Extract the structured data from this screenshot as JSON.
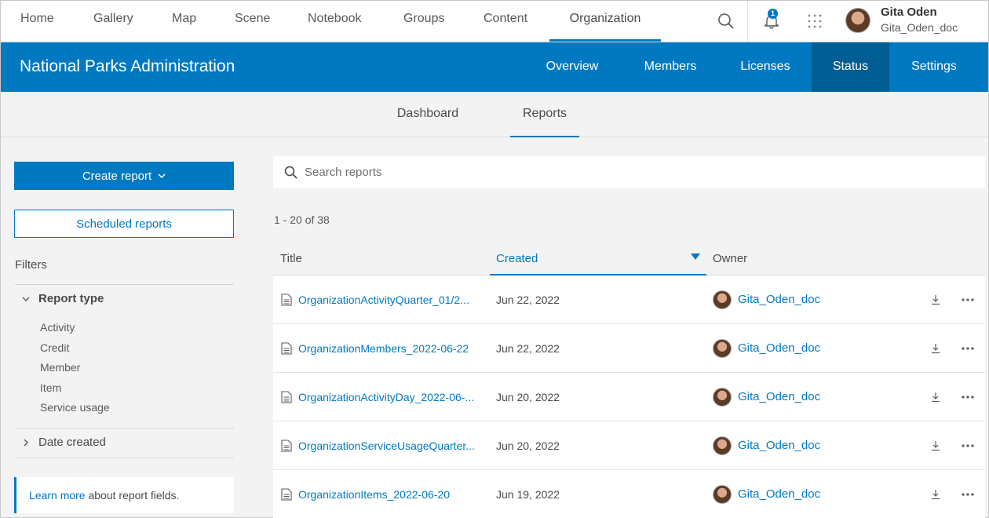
{
  "topnav": {
    "items": [
      {
        "label": "Home"
      },
      {
        "label": "Gallery"
      },
      {
        "label": "Map"
      },
      {
        "label": "Scene"
      },
      {
        "label": "Notebook"
      },
      {
        "label": "Groups"
      },
      {
        "label": "Content"
      },
      {
        "label": "Organization",
        "active": true
      }
    ],
    "notification_count": "1",
    "user": {
      "name": "Gita Oden",
      "username": "Gita_Oden_doc"
    }
  },
  "org": {
    "title": "National Parks Administration",
    "tabs": [
      {
        "label": "Overview"
      },
      {
        "label": "Members"
      },
      {
        "label": "Licenses"
      },
      {
        "label": "Status",
        "active": true
      },
      {
        "label": "Settings"
      }
    ]
  },
  "subtabs": [
    {
      "label": "Dashboard"
    },
    {
      "label": "Reports",
      "active": true
    }
  ],
  "sidebar": {
    "create_label": "Create report",
    "scheduled_label": "Scheduled reports",
    "filters_label": "Filters",
    "report_type": {
      "label": "Report type",
      "options": [
        "Activity",
        "Credit",
        "Member",
        "Item",
        "Service usage"
      ]
    },
    "date_created": {
      "label": "Date created"
    },
    "info": {
      "link": "Learn more",
      "text": " about report fields."
    }
  },
  "search": {
    "placeholder": "Search reports"
  },
  "results": {
    "count": "1 - 20 of 38"
  },
  "table": {
    "headers": {
      "title": "Title",
      "created": "Created",
      "owner": "Owner"
    },
    "sort": {
      "column": "created",
      "direction": "descending"
    },
    "rows": [
      {
        "title": "OrganizationActivityQuarter_01/2...",
        "created": "Jun 22, 2022",
        "owner": "Gita_Oden_doc"
      },
      {
        "title": "OrganizationMembers_2022-06-22",
        "created": "Jun 22, 2022",
        "owner": "Gita_Oden_doc"
      },
      {
        "title": "OrganizationActivityDay_2022-06-...",
        "created": "Jun 20, 2022",
        "owner": "Gita_Oden_doc"
      },
      {
        "title": "OrganizationServiceUsageQuarter...",
        "created": "Jun 20, 2022",
        "owner": "Gita_Oden_doc"
      },
      {
        "title": "OrganizationItems_2022-06-20",
        "created": "Jun 19, 2022",
        "owner": "Gita_Oden_doc"
      }
    ]
  },
  "colors": {
    "accent": "#0079c1",
    "accent_dark": "#005e95",
    "page_bg": "#f3f3f3"
  }
}
